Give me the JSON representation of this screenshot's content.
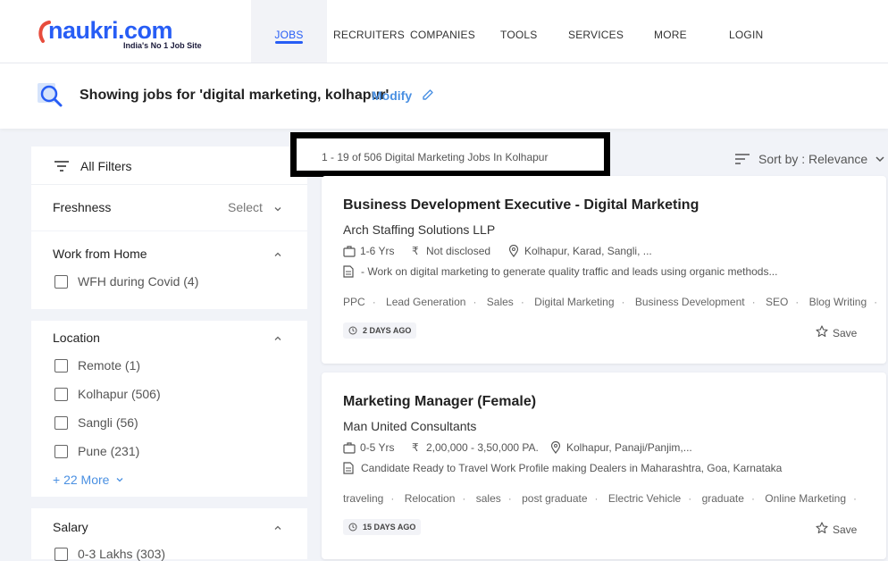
{
  "header": {
    "logo_text": "naukri.com",
    "logo_tagline": "India's No 1 Job Site",
    "nav": [
      {
        "label": "JOBS"
      },
      {
        "label": "RECRUITERS"
      },
      {
        "label": "COMPANIES"
      },
      {
        "label": "TOOLS"
      },
      {
        "label": "SERVICES"
      },
      {
        "label": "MORE"
      },
      {
        "label": "LOGIN"
      }
    ]
  },
  "search": {
    "summary": "Showing jobs for 'digital marketing, kolhapur'",
    "modify_label": "Modify"
  },
  "filters": {
    "all_filters_label": "All Filters",
    "freshness": {
      "title": "Freshness",
      "select_label": "Select"
    },
    "wfh": {
      "title": "Work from Home",
      "options": [
        {
          "label": "WFH during Covid",
          "count": "(4)"
        }
      ]
    },
    "location": {
      "title": "Location",
      "options": [
        {
          "label": "Remote",
          "count": "(1)"
        },
        {
          "label": "Kolhapur",
          "count": "(506)"
        },
        {
          "label": "Sangli",
          "count": "(56)"
        },
        {
          "label": "Pune",
          "count": "(231)"
        }
      ],
      "more_label": "+ 22 More"
    },
    "salary": {
      "title": "Salary",
      "options": [
        {
          "label": "0-3 Lakhs",
          "count": "(303)"
        }
      ]
    }
  },
  "results": {
    "count_text": "1 - 19 of 506  Digital Marketing Jobs In Kolhapur",
    "sort_label": "Sort by : Relevance"
  },
  "jobs": [
    {
      "title": "Business Development Executive - Digital Marketing",
      "company": "Arch Staffing Solutions LLP",
      "experience": "1-6 Yrs",
      "salary": "Not disclosed",
      "location": "Kolhapur, Karad, Sangli, ...",
      "description": "- Work on digital marketing to generate quality traffic and leads using organic methods...",
      "tags": [
        "PPC",
        "Lead Generation",
        "Sales",
        "Digital Marketing",
        "Business Development",
        "SEO",
        "Blog Writing"
      ],
      "age": "2 DAYS AGO",
      "save_label": "Save"
    },
    {
      "title": "Marketing Manager (Female)",
      "company": "Man United Consultants",
      "experience": "0-5 Yrs",
      "salary": "2,00,000 - 3,50,000 PA.",
      "location": "Kolhapur, Panaji/Panjim,...",
      "description": "Candidate Ready to Travel Work Profile making Dealers in Maharashtra, Goa, Karnataka",
      "tags": [
        "traveling",
        "Relocation",
        "sales",
        "post graduate",
        "Electric Vehicle",
        "graduate",
        "Online Marketing"
      ],
      "age": "15 DAYS AGO",
      "save_label": "Save"
    }
  ],
  "colors": {
    "brand": "#275df5",
    "link": "#4a90e2"
  }
}
